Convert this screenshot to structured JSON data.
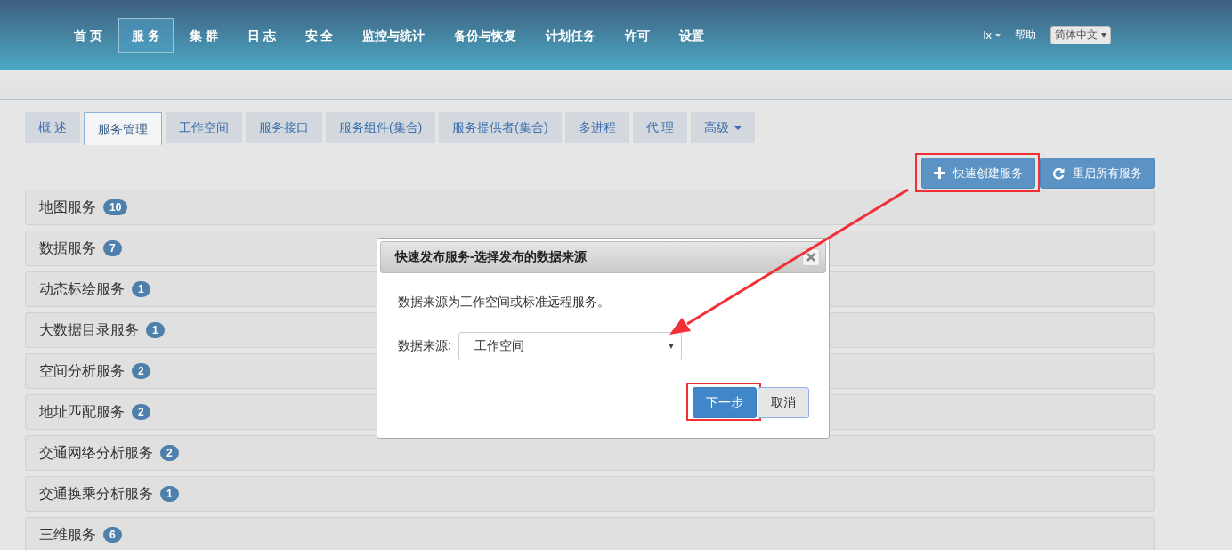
{
  "nav": {
    "items": [
      {
        "label": "首 页",
        "selected": false
      },
      {
        "label": "服 务",
        "selected": true
      },
      {
        "label": "集 群",
        "selected": false
      },
      {
        "label": "日 志",
        "selected": false
      },
      {
        "label": "安 全",
        "selected": false
      },
      {
        "label": "监控与统计",
        "selected": false
      },
      {
        "label": "备份与恢复",
        "selected": false
      },
      {
        "label": "计划任务",
        "selected": false
      },
      {
        "label": "许可",
        "selected": false
      },
      {
        "label": "设置",
        "selected": false
      }
    ],
    "user": "lx",
    "help": "帮助",
    "language": "简体中文"
  },
  "tabs": [
    {
      "label": "概 述",
      "selected": false,
      "kind": "plain"
    },
    {
      "label": "服务管理",
      "selected": true,
      "kind": "plain"
    },
    {
      "label": "工作空间",
      "selected": false,
      "kind": "plain"
    },
    {
      "label": "服务接口",
      "selected": false,
      "kind": "plain"
    },
    {
      "label": "服务组件(集合)",
      "selected": false,
      "kind": "plain"
    },
    {
      "label": "服务提供者(集合)",
      "selected": false,
      "kind": "plain"
    },
    {
      "label": "多进程",
      "selected": false,
      "kind": "plain"
    },
    {
      "label": "代 理",
      "selected": false,
      "kind": "plain"
    },
    {
      "label": "高级",
      "selected": false,
      "kind": "dropdown"
    }
  ],
  "actions": [
    {
      "label": "快速创建服务",
      "kind": "plus",
      "highlighted": true
    },
    {
      "label": "重启所有服务",
      "kind": "refresh",
      "highlighted": false
    }
  ],
  "service_groups": [
    {
      "name": "地图服务",
      "count": "10"
    },
    {
      "name": "数据服务",
      "count": "7"
    },
    {
      "name": "动态标绘服务",
      "count": "1"
    },
    {
      "name": "大数据目录服务",
      "count": "1"
    },
    {
      "name": "空间分析服务",
      "count": "2"
    },
    {
      "name": "地址匹配服务",
      "count": "2"
    },
    {
      "name": "交通网络分析服务",
      "count": "2"
    },
    {
      "name": "交通换乘分析服务",
      "count": "1"
    },
    {
      "name": "三维服务",
      "count": "6"
    }
  ],
  "dialog": {
    "title": "快速发布服务-选择发布的数据来源",
    "message": "数据来源为工作空间或标准远程服务。",
    "field_label": "数据来源:",
    "field_value": "工作空间",
    "buttons": [
      {
        "label": "下一步",
        "kind": "primary",
        "highlighted": true
      },
      {
        "label": "取消",
        "kind": "default",
        "highlighted": false
      }
    ]
  },
  "annotation_arrow": true
}
